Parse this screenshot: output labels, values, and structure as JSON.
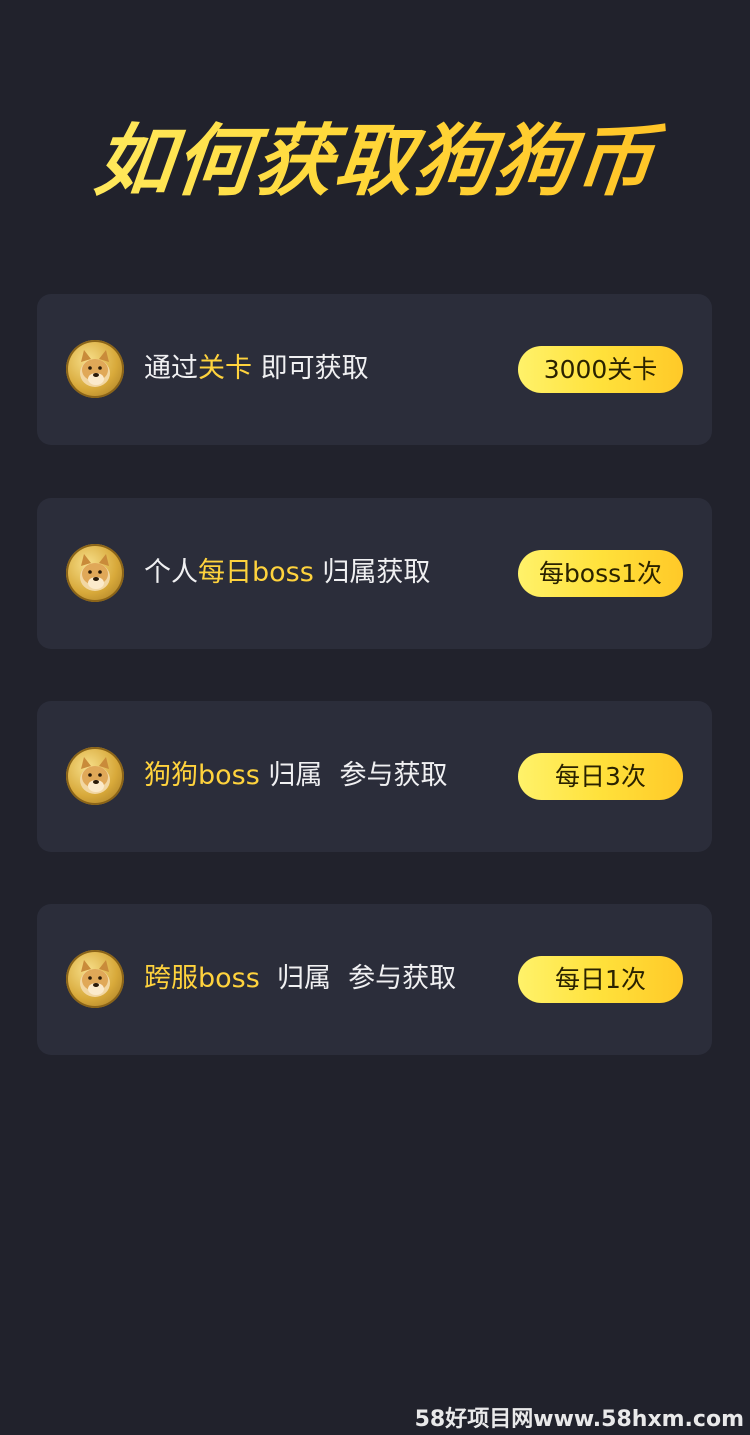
{
  "title": "如何获取狗狗币",
  "cards": [
    {
      "icon": "dogecoin-icon",
      "text_pre": "通过",
      "text_highlight": "关卡",
      "text_post": " 即可获取",
      "badge": "3000关卡"
    },
    {
      "icon": "dogecoin-icon",
      "text_pre": "个人",
      "text_highlight": "每日boss",
      "text_post": " 归属获取",
      "badge": "每boss1次"
    },
    {
      "icon": "dogecoin-icon",
      "text_pre": "",
      "text_highlight": "狗狗boss",
      "text_post": " 归属  参与获取",
      "badge": "每日3次"
    },
    {
      "icon": "dogecoin-icon",
      "text_pre": "",
      "text_highlight": "跨服boss",
      "text_post": "  归属  参与获取",
      "badge": "每日1次"
    }
  ],
  "watermark": "58好项目网www.58hxm.com",
  "colors": {
    "background": "#21222c",
    "card": "#2b2d3a",
    "accent": "#ffd33d",
    "text": "#f0f0f2"
  }
}
